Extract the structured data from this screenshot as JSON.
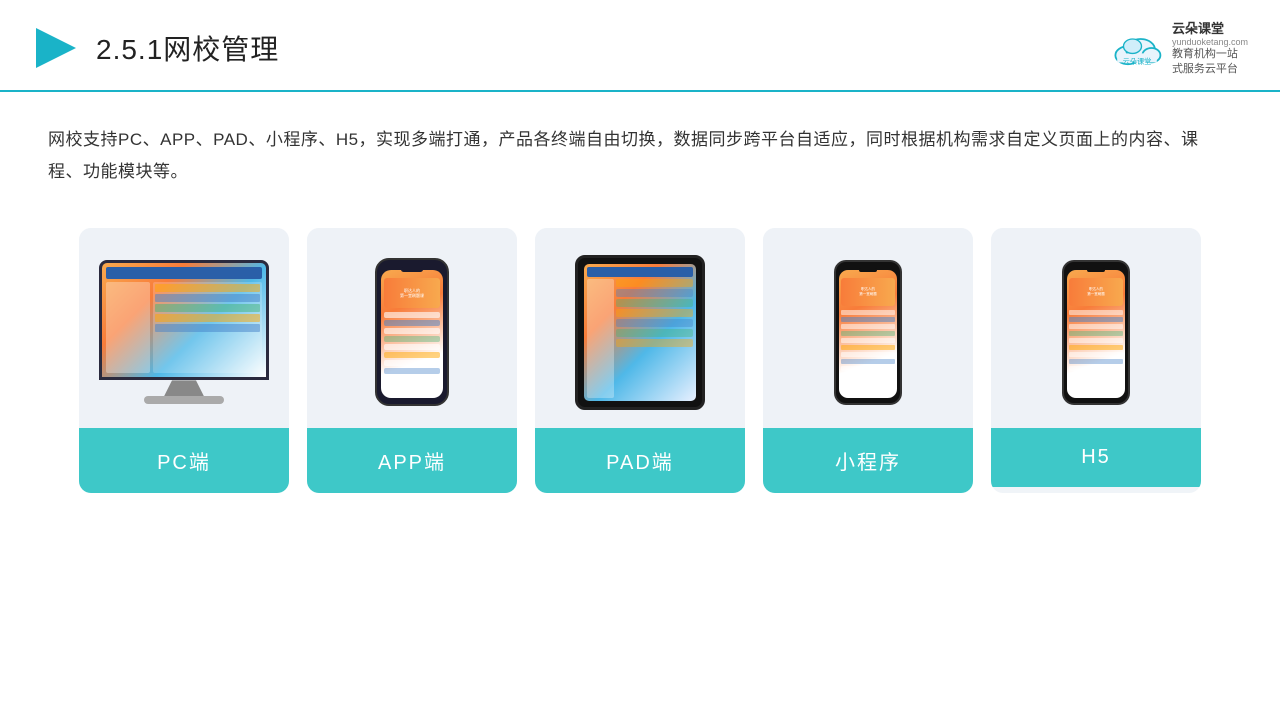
{
  "header": {
    "title_prefix": "2.5.1",
    "title_main": "网校管理",
    "logo_name": "云朵课堂",
    "logo_url": "yunduoketang.com",
    "logo_tagline": "教育机构一站\n式服务云平台"
  },
  "description": {
    "text": "网校支持PC、APP、PAD、小程序、H5，实现多端打通，产品各终端自由切换，数据同步跨平台自适应，同时根据机构需求自定义页面上的内容、课程、功能模块等。"
  },
  "cards": [
    {
      "id": "pc",
      "label": "PC端"
    },
    {
      "id": "app",
      "label": "APP端"
    },
    {
      "id": "pad",
      "label": "PAD端"
    },
    {
      "id": "miniprogram",
      "label": "小程序"
    },
    {
      "id": "h5",
      "label": "H5"
    }
  ],
  "colors": {
    "accent": "#3ec8c8",
    "header_border": "#1ab3c8",
    "bg_card": "#eef2f7",
    "title": "#222",
    "text": "#333"
  }
}
